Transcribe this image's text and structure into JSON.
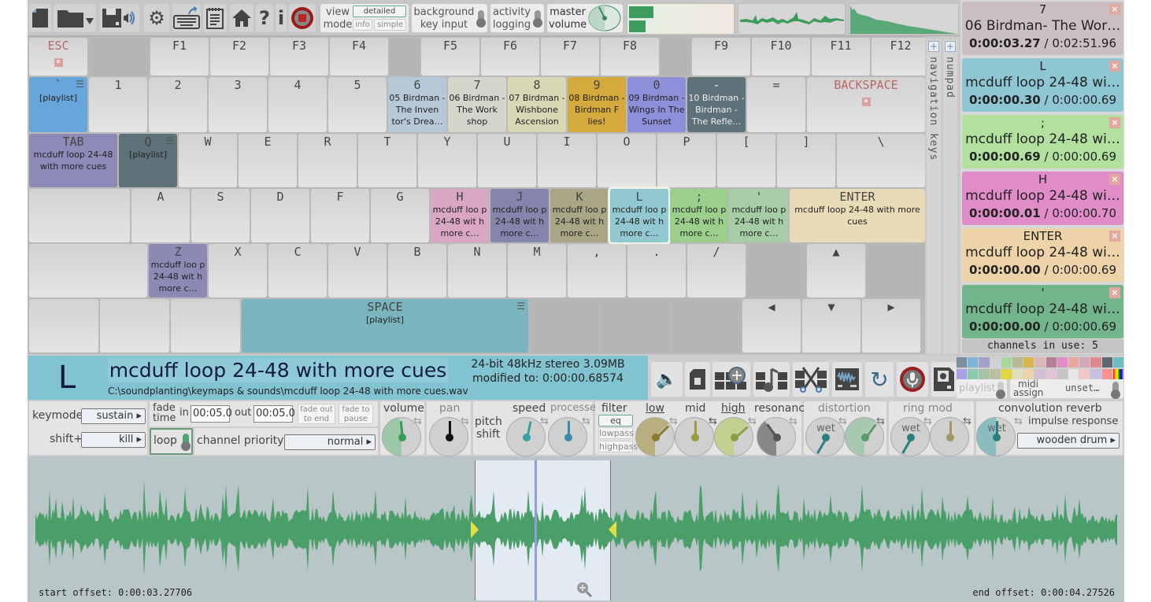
{
  "toolbar": {
    "icons": [
      "new-file-icon",
      "open-folder-icon",
      "save-audio-icon",
      "settings-gear-icon",
      "keyboard-export-icon",
      "notepad-icon",
      "home-icon",
      "help-icon",
      "info-icon",
      "record-stop-icon"
    ],
    "view_mode": {
      "label_line1": "view",
      "label_line2": "mode",
      "options": [
        "detailed",
        "info",
        "simple"
      ],
      "selected": "detailed"
    },
    "background_key_input": {
      "line1": "background",
      "line2": "key input",
      "enabled": false
    },
    "activity_logging": {
      "line1": "activity",
      "line2": "logging",
      "enabled": false
    },
    "master_volume": {
      "line1": "master",
      "line2": "volume",
      "value_fraction": 0.47
    },
    "level_meter": {
      "left": 0.23,
      "right": 0.16
    }
  },
  "keyboard": {
    "rows": [
      [
        {
          "key": "ESC",
          "kind": "esc"
        },
        {
          "blank": true
        },
        {
          "key": "F1"
        },
        {
          "key": "F2"
        },
        {
          "key": "F3"
        },
        {
          "key": "F4"
        },
        {
          "blank": true
        },
        {
          "key": "F5"
        },
        {
          "key": "F6"
        },
        {
          "key": "F7"
        },
        {
          "key": "F8"
        },
        {
          "blank": true
        },
        {
          "key": "F9"
        },
        {
          "key": "F10"
        },
        {
          "key": "F11"
        },
        {
          "key": "F12"
        }
      ],
      [
        {
          "key": "`",
          "sub": "[playlist]",
          "color": "#66a6da",
          "playlist": true
        },
        {
          "key": "1"
        },
        {
          "key": "2"
        },
        {
          "key": "3"
        },
        {
          "key": "4"
        },
        {
          "key": "5"
        },
        {
          "key": "6",
          "sub": "05 Birdman - The Inven tor's Drea…",
          "color": "#b7c9d9"
        },
        {
          "key": "7",
          "sub": "06 Birdman - The Work shop",
          "color": "#d4d6cc"
        },
        {
          "key": "8",
          "sub": "07 Birdman - Wishbone Ascension",
          "color": "#d8d8b4"
        },
        {
          "key": "9",
          "sub": "08 Birdman - Birdman F lies!",
          "color": "#d4aa3c"
        },
        {
          "key": "0",
          "sub": "09 Birdman - Wings In The Sunset",
          "color": "#8d8fd9"
        },
        {
          "key": "-",
          "sub": "10 Birdman - Birdman - The Refle…",
          "color": "#5f7178",
          "dark": true
        },
        {
          "key": "="
        },
        {
          "key": "BACKSPACE",
          "kind": "esc"
        }
      ],
      [
        {
          "key": "TAB",
          "sub": "mcduff loop 24-48 with more cues",
          "color": "#8e8ab7"
        },
        {
          "key": "Q",
          "sub": "[playlist]",
          "color": "#5e7279",
          "playlist": true
        },
        {
          "key": "W"
        },
        {
          "key": "E"
        },
        {
          "key": "R"
        },
        {
          "key": "T"
        },
        {
          "key": "Y"
        },
        {
          "key": "U"
        },
        {
          "key": "I"
        },
        {
          "key": "O"
        },
        {
          "key": "P"
        },
        {
          "key": "["
        },
        {
          "key": "]"
        },
        {
          "key": "\\"
        }
      ],
      [
        {
          "blank": false,
          "key": ""
        },
        {
          "key": "A"
        },
        {
          "key": "S"
        },
        {
          "key": "D"
        },
        {
          "key": "F"
        },
        {
          "key": "G"
        },
        {
          "key": "H",
          "sub": "mcduff loo p 24-48 wit h more c…",
          "color": "#d9a6c4"
        },
        {
          "key": "J",
          "sub": "mcduff loo p 24-48 wit h more c…",
          "color": "#8584ac"
        },
        {
          "key": "K",
          "sub": "mcduff loo p 24-48 wit h more c…",
          "color": "#a8a684"
        },
        {
          "key": "L",
          "sub": "mcduff loo p 24-48 wit h more c…",
          "color": "#92c8cf",
          "selected": true
        },
        {
          "key": ";",
          "sub": "mcduff loo p 24-48 wit h more c…",
          "color": "#9ccf8c"
        },
        {
          "key": "'",
          "sub": "mcduff loo p 24-48 wit h more c…",
          "color": "#a6cda6"
        },
        {
          "key": "ENTER",
          "sub": "mcduff loop 24-48 with more cues",
          "color": "#e8dcb8"
        }
      ],
      [
        {
          "key": ""
        },
        {
          "key": "Z",
          "sub": "mcduff loo p 24-48 wit h more c…",
          "color": "#8c8ab5"
        },
        {
          "key": "X"
        },
        {
          "key": "C"
        },
        {
          "key": "V"
        },
        {
          "key": "B"
        },
        {
          "key": "N"
        },
        {
          "key": "M"
        },
        {
          "key": ","
        },
        {
          "key": "."
        },
        {
          "key": "/"
        },
        {
          "key": "",
          "blank": true
        },
        {
          "key": "▲"
        },
        {
          "key": "",
          "blank": true
        }
      ],
      [
        {
          "key": ""
        },
        {
          "key": ""
        },
        {
          "key": ""
        },
        {
          "key": "SPACE",
          "sub": "[playlist]",
          "color": "#7ab4be",
          "playlist": true
        },
        {
          "key": "",
          "blank": true
        },
        {
          "key": "",
          "blank": true
        },
        {
          "key": "",
          "blank": true
        },
        {
          "key": "◀"
        },
        {
          "key": "▼"
        },
        {
          "key": "▶"
        }
      ]
    ],
    "side_tabs": {
      "navigation": "navigation keys",
      "numpad": "numpad"
    }
  },
  "channels": {
    "items": [
      {
        "key": "7",
        "name": "06 Birdman- The Wor…",
        "elapsed": "0:00:03.27",
        "total": "0:02:51.96",
        "color": "#c9bfc4"
      },
      {
        "key": "L",
        "name": "mcduff loop 24-48 wi…",
        "elapsed": "0:00:00.30",
        "total": "0:00:00.69",
        "color": "#8fc6d4"
      },
      {
        "key": ";",
        "name": "mcduff loop 24-48 wi…",
        "elapsed": "0:00:00.69",
        "total": "0:00:00.69",
        "color": "#b2e09e"
      },
      {
        "key": "H",
        "name": "mcduff loop 24-48 wi…",
        "elapsed": "0:00:00.01",
        "total": "0:00:00.70",
        "color": "#e08cc8"
      },
      {
        "key": "ENTER",
        "name": "mcduff loop 24-48 wi…",
        "elapsed": "0:00:00.00",
        "total": "0:00:00.69",
        "color": "#eed2a8"
      },
      {
        "key": "'",
        "name": "mcduff loop 24-48 wi…",
        "elapsed": "0:00:00.00",
        "total": "0:00:00.69",
        "color": "#72b48c"
      }
    ],
    "count_label": "channels in use: 5"
  },
  "sound_info": {
    "key": "L",
    "title": "mcduff loop 24-48 with more cues",
    "path": "C:\\soundplanting\\keymaps & sounds\\mcduff loop 24-48 with more cues.wav",
    "format": "24-bit 48kHz stereo 3.09MB",
    "modified": "modified to: 0:00:00.68574"
  },
  "actions": {
    "icons": [
      "open-sound-icon",
      "new-blank-icon",
      "add-to-keys-icon",
      "music-keys-icon",
      "cut-keys-icon",
      "waveform-editor-icon",
      "refresh-icon",
      "microphone-record-icon",
      "save-settings-icon"
    ],
    "palette": [
      "#7c8ea4",
      "#7fb4d9",
      "#a6a1c9",
      "#ccd2d6",
      "#a8d89c",
      "#b8b894",
      "#d8b44c",
      "#d8b8b8",
      "#b88098",
      "#e08cc8",
      "#e8a8a0",
      "#d4a8b8",
      "#e08890",
      "#5e6a70",
      "#6cbcc4",
      "#a8a0e8",
      "#8cc8b0",
      "#a4c4a4",
      "#b8c0a0",
      "#e0d840",
      "#e0e0b8",
      "#eed2a8",
      "#d0c0d4",
      "#e4c4d4",
      "#c4c4c4",
      "#e8e4e8",
      "#f0c8c8",
      "#c8c0e0",
      "#ff9090"
    ],
    "playlist_label": "playlist",
    "midi_assign": {
      "line1": "midi",
      "line2": "assign",
      "value": "unset…"
    }
  },
  "controls": {
    "keymode_label": "keymode",
    "keymode_value": "sustain",
    "shift_label": "shift+",
    "shift_value": "kill",
    "fade_label1": "fade",
    "fade_label2": "time",
    "fade_in_label": "in",
    "fade_in_value": "00:05.0",
    "fade_out_label": "out",
    "fade_out_value": "00:05.0",
    "fade_out_to_end": [
      "fade out",
      "to end"
    ],
    "fade_to_pause": [
      "fade to",
      "pause"
    ],
    "loop_label": "loop",
    "loop_enabled": true,
    "channel_priority_label": "channel priority",
    "channel_priority_value": "normal",
    "volume_label": "volume",
    "volume_value": 0.48,
    "pan_label": "pan",
    "pan_value": 0.5,
    "pitch_shift_label1": "pitch",
    "pitch_shift_label2": "shift",
    "speed_label": "speed",
    "speed_value": 0.54,
    "processed_label": "processed",
    "processed_value": 0.5,
    "filter_label": "filter",
    "filter_options": [
      "eq",
      "lowpass",
      "highpass"
    ],
    "filter_selected": "eq",
    "low_label": "low",
    "low_value": 0.65,
    "mid_label": "mid",
    "mid_value": 0.5,
    "high_label": "high",
    "high_value": 0.66,
    "resonance_label": "resonance",
    "resonance_value": 0.38,
    "distortion_label": "distortion",
    "distortion_wet_label": "wet",
    "distortion_wet": 0.0,
    "distortion_amount": 0.62,
    "ring_mod_label": "ring  mod",
    "ring_wet_label": "wet",
    "ring_wet": 0.0,
    "ring_freq": 0.5,
    "reverb_label": "convolution reverb",
    "reverb_wet_label": "wet",
    "reverb_wet": 0.5,
    "impulse_label": "impulse response",
    "impulse_value": "wooden drum"
  },
  "waveform": {
    "start_offset": "start offset: 0:00:03.27706",
    "end_offset": "end offset: 0:00:04.27526",
    "selection_start_fraction": 0.41,
    "selection_end_fraction": 0.535,
    "playhead_fraction": 0.465
  }
}
